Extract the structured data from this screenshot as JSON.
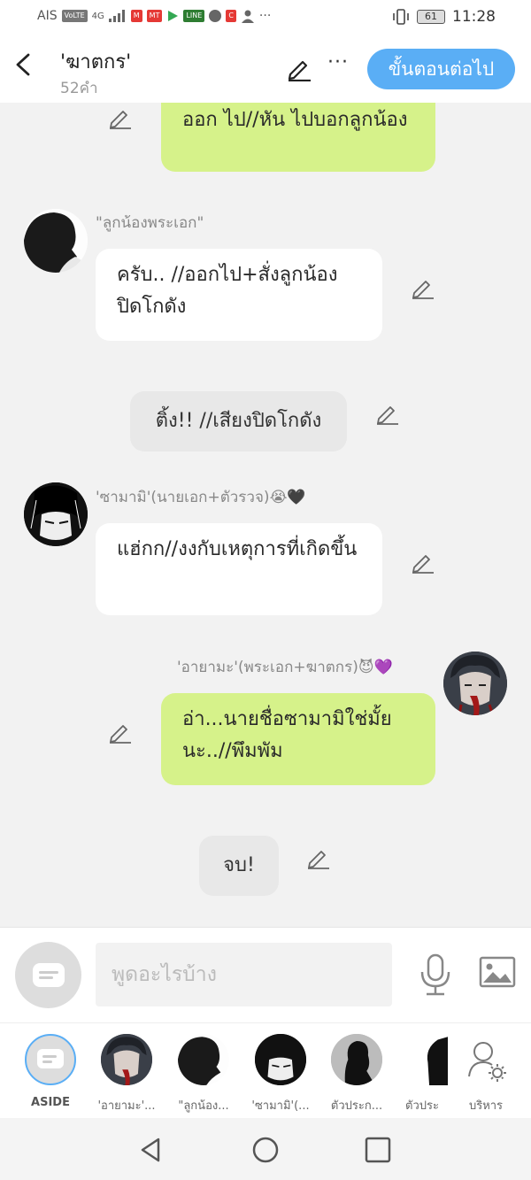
{
  "status_bar": {
    "carrier": "AIS",
    "volte": "VoLTE",
    "network": "4G",
    "battery": "61",
    "time": "11:28",
    "more": "···"
  },
  "header": {
    "title": "'ฆาตกร'",
    "subtitle": "52คำ",
    "next_button": "ขั้นตอนต่อไป",
    "more": "···"
  },
  "messages": [
    {
      "type": "self",
      "text": "ออก ไป//หัน ไปบอกลูกน้อง"
    },
    {
      "type": "other",
      "name": "\"ลูกน้องพระเอก\"",
      "text": "ครับ.. //ออกไป+สั่งลูกน้องปิดโกดัง"
    },
    {
      "type": "aside",
      "text": "ติ้ง!! //เสียงปิดโกดัง"
    },
    {
      "type": "other",
      "name": "'ซามามิ'(นายเอก+ตัวรวจ)😭🖤",
      "text": "แฮ่กก//งงกับเหตุการที่เกิดขึ้น"
    },
    {
      "type": "self",
      "name": "'อายามะ'(พระเอก+ฆาตกร)😈💜",
      "text": "อ่า...นายชื่อซามามิใช่มั้ยนะ..//พึมพัม"
    },
    {
      "type": "aside",
      "text": "จบ!"
    }
  ],
  "input": {
    "placeholder": "พูดอะไรบ้าง"
  },
  "characters": [
    {
      "label": "ASIDE"
    },
    {
      "label": "'อายามะ'..."
    },
    {
      "label": "\"ลูกน้อง..."
    },
    {
      "label": "'ซามามิ'(..."
    },
    {
      "label": "ตัวประก..."
    },
    {
      "label": "ตัวประ"
    },
    {
      "label": "บริหาร"
    }
  ]
}
